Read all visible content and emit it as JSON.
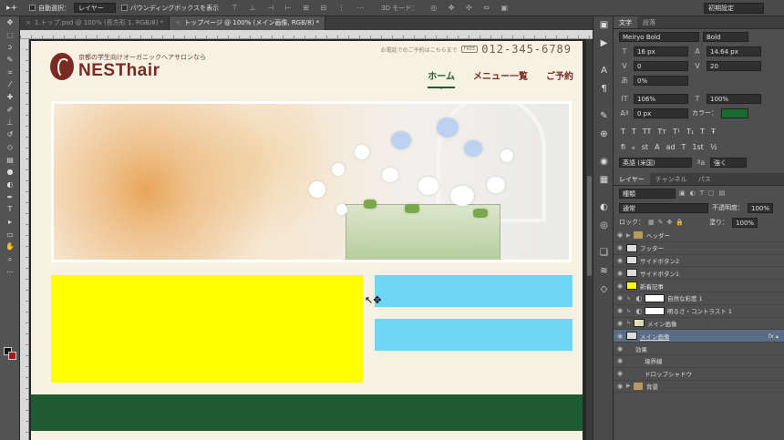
{
  "options_bar": {
    "tool_glyph": "▸+",
    "auto_select_label": "自動選択：",
    "auto_select_value": "レイヤー",
    "bounding_box_label": "バウンディングボックスを表示",
    "align_icons": "⊤ ⊥ ⊣ ⊢ ⊞ ⊟ ⋮ ⋯",
    "mode_3d_label": "3D モード：",
    "mode_3d_icons": "◎ ✥ ✣ ⇔ ▣",
    "workspace": "初期設定"
  },
  "doc_tabs": [
    {
      "label": "1.トップ.psd @ 100% (長方形 1, RGB/8) *",
      "active": false
    },
    {
      "label": "トップページ @ 100% (メイン画像, RGB/8) *",
      "active": true
    }
  ],
  "site": {
    "phone_prefix": "お電話でのご予約はこちらまで",
    "free_badge": "FREE",
    "phone": "012-345-6789",
    "tagline": "京都の学生向けオーガニックヘアサロンなら",
    "brand": "NESThair",
    "nav": [
      {
        "label": "ホーム",
        "active": true
      },
      {
        "label": "メニュー一覧",
        "active": false
      },
      {
        "label": "ご予約",
        "active": false
      }
    ]
  },
  "character_panel": {
    "tabs": [
      "文字",
      "段落"
    ],
    "font_family": "Meiryo Bold",
    "font_style": "Bold",
    "font_size": "16 px",
    "leading": "14.64 px",
    "kerning": "0",
    "tracking": "20",
    "tsume": "0%",
    "vscale": "106%",
    "hscale": "100%",
    "baseline": "0 px",
    "color_label": "カラー：",
    "color": "#1a6b2f",
    "style_glyphs": [
      "T",
      "T",
      "TT",
      "Tт",
      "T¹",
      "T₁",
      "T",
      "Ŧ"
    ],
    "ot_glyphs": [
      "fi",
      "ℴ",
      "st",
      "A",
      "ad",
      "T",
      "1st",
      "½"
    ],
    "language": "英語 (米国)",
    "aa_label": "ªa",
    "antialias": "強く"
  },
  "layers_panel": {
    "tabs": [
      "レイヤー",
      "チャンネル",
      "パス"
    ],
    "filter": "種類",
    "blend_mode": "通常",
    "opacity_label": "不透明度：",
    "opacity": "100%",
    "lock_label": "ロック：",
    "fill_label": "塗り：",
    "fill": "100%",
    "layers": [
      {
        "name": "ヘッダー",
        "kind": "folder",
        "collapsed": true
      },
      {
        "name": "フッター",
        "kind": "layer"
      },
      {
        "name": "サイドボタン2",
        "kind": "layer"
      },
      {
        "name": "サイドボタン1",
        "kind": "layer"
      },
      {
        "name": "新着記事",
        "kind": "yellow"
      },
      {
        "name": "自然な彩度 1",
        "kind": "adjust"
      },
      {
        "name": "明るさ・コントラスト 1",
        "kind": "adjust"
      },
      {
        "name": "メイン画像",
        "kind": "image"
      },
      {
        "name": "メイン画像",
        "kind": "selected"
      },
      {
        "name": "効果",
        "kind": "effect-group"
      },
      {
        "name": "境界線",
        "kind": "effect"
      },
      {
        "name": "ドロップシャドウ",
        "kind": "effect"
      },
      {
        "name": "背景",
        "kind": "folder",
        "collapsed": true
      }
    ]
  }
}
